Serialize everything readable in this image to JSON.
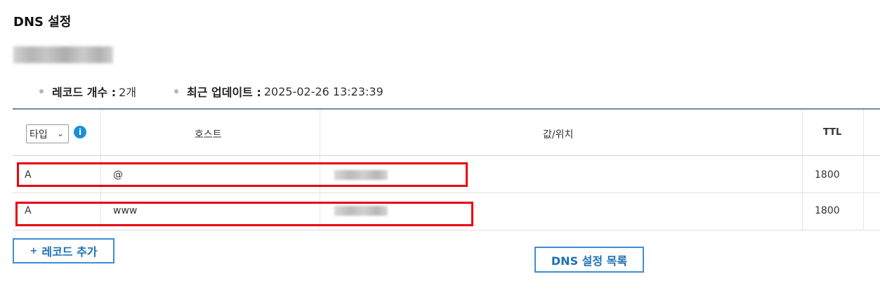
{
  "page": {
    "title": "DNS 설정"
  },
  "summary": {
    "record_count_label": "레코드 개수 :",
    "record_count_value": "2개",
    "last_update_label": "최근 업데이트 :",
    "last_update_value": "2025-02-26 13:23:39"
  },
  "table": {
    "type_filter": {
      "selected": "타입"
    },
    "headers": {
      "host": "호스트",
      "value": "값/위치",
      "ttl": "TTL"
    },
    "rows": [
      {
        "type": "A",
        "host": "@",
        "ttl": "1800"
      },
      {
        "type": "A",
        "host": "www",
        "ttl": "1800"
      }
    ]
  },
  "buttons": {
    "add_record": "레코드 추가",
    "dns_list": "DNS 설정 목록"
  },
  "colors": {
    "accent": "#1f6fb5",
    "highlight": "#e60012",
    "info": "#1b8fd6"
  }
}
